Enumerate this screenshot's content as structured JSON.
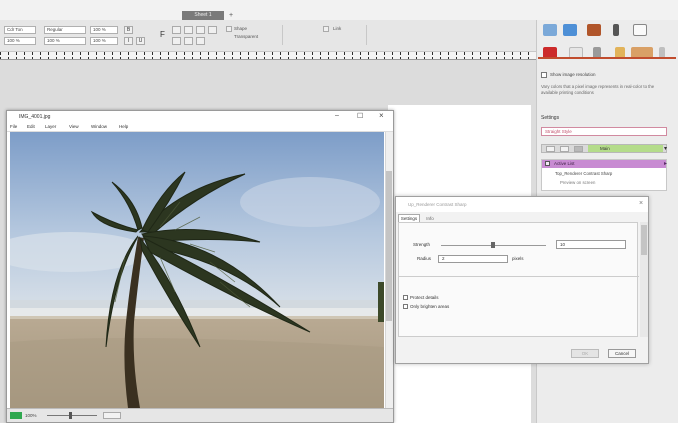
{
  "tabs": {
    "active": "Sheet 1",
    "add": "+"
  },
  "toolbar": {
    "font_name": "Cdr Ton",
    "font_style": "Regular",
    "font_size": "100 %",
    "char_spacing": "100 %",
    "line_spacing": "100 %",
    "zoom_value": "100 %",
    "zoom_value2": "100 %",
    "link": "Link",
    "shape_label": "Shape",
    "transparency": "Transparent",
    "bold": "B",
    "italic": "I",
    "underline": "U",
    "strike": "F"
  },
  "image_window": {
    "title": "IMG_4001.jpg",
    "menu": [
      "File",
      "Edit",
      "Layer",
      "View",
      "Window",
      "Help"
    ],
    "minimize": "–",
    "maximize": "☐",
    "close": "×",
    "zoom": "100%"
  },
  "right_panel": {
    "checkbox_label": "Show image resolution",
    "note": "Vary colors that a pixel image represents in real-color to the available printing conditions",
    "settings_label": "Settings",
    "settings_value": "Straight Style",
    "preset_value": "Main",
    "active_item": "Active List",
    "sub_item": "Top_Renderer Contrast Sharp",
    "sub_detail": "Preview on screen"
  },
  "dialog": {
    "title": "Up_Renderer Contrast Sharp",
    "tab_settings": "Settings",
    "tab_info": "Info",
    "strength_label": "Strength",
    "strength_value": "10",
    "radius_label": "Radius",
    "radius_value": "2",
    "radius_unit": "pixels",
    "check1": "Protect details",
    "check2": "Only brighten areas",
    "ok": "OK",
    "cancel": "Cancel"
  },
  "colors": {
    "accent": "#c14d2e",
    "highlight": "#c88bd2",
    "green": "#b4dc8a"
  }
}
